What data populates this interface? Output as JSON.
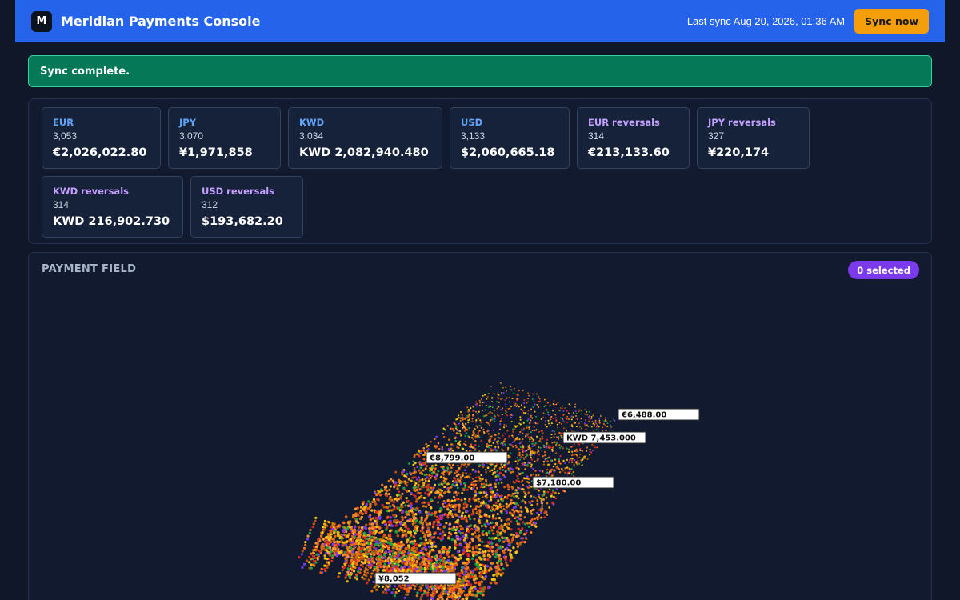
{
  "header": {
    "logo_letter": "M",
    "title": "Meridian Payments Console",
    "last_sync": "Last sync Aug 20, 2026, 01:36 AM",
    "sync_button": "Sync now"
  },
  "toast": {
    "message": "Sync complete."
  },
  "summary": {
    "cards": [
      {
        "label": "EUR",
        "count": "3,053",
        "amount": "€2,026,022.80",
        "kind": "base"
      },
      {
        "label": "JPY",
        "count": "3,070",
        "amount": "¥1,971,858",
        "kind": "base"
      },
      {
        "label": "KWD",
        "count": "3,034",
        "amount": "KWD 2,082,940.480",
        "kind": "base"
      },
      {
        "label": "USD",
        "count": "3,133",
        "amount": "$2,060,665.18",
        "kind": "base"
      },
      {
        "label": "EUR reversals",
        "count": "314",
        "amount": "€213,133.60",
        "kind": "rev"
      },
      {
        "label": "JPY reversals",
        "count": "327",
        "amount": "¥220,174",
        "kind": "rev"
      },
      {
        "label": "KWD reversals",
        "count": "314",
        "amount": "KWD 216,902.730",
        "kind": "rev"
      },
      {
        "label": "USD reversals",
        "count": "312",
        "amount": "$193,682.20",
        "kind": "rev"
      }
    ]
  },
  "field": {
    "title": "PAYMENT FIELD",
    "selected_badge": "0 selected",
    "tags": [
      {
        "text": "€6,488.00"
      },
      {
        "text": "KWD 7,453.000"
      },
      {
        "text": "€8,799.00"
      },
      {
        "text": "$7,180.00"
      },
      {
        "text": "¥8,052"
      }
    ],
    "dot_colors": [
      "#f97316",
      "#ea580c",
      "#facc15",
      "#eab308",
      "#dc2626",
      "#16a34a",
      "#7c3aed",
      "#fb923c",
      "#d97706",
      "#b45309"
    ]
  }
}
